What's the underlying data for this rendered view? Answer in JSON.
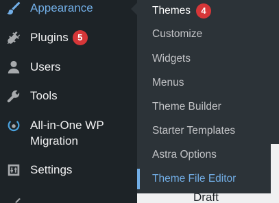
{
  "sidebar": {
    "items": [
      {
        "label": "Appearance",
        "icon": "paintbrush-icon",
        "active": true
      },
      {
        "label": "Plugins",
        "icon": "plug-icon",
        "badge": "5"
      },
      {
        "label": "Users",
        "icon": "user-icon"
      },
      {
        "label": "Tools",
        "icon": "wrench-icon"
      },
      {
        "label_line1": "All-in-One WP",
        "label_line2": "Migration",
        "icon": "migration-icon"
      },
      {
        "label": "Settings",
        "icon": "settings-sliders-icon"
      }
    ]
  },
  "submenu": {
    "items": [
      {
        "label": "Themes",
        "badge": "4"
      },
      {
        "label": "Customize"
      },
      {
        "label": "Widgets"
      },
      {
        "label": "Menus"
      },
      {
        "label": "Theme Builder"
      },
      {
        "label": "Starter Templates"
      },
      {
        "label": "Astra Options"
      },
      {
        "label": "Theme File Editor",
        "current": true
      }
    ]
  },
  "content": {
    "partial_text": "Draft"
  },
  "colors": {
    "sidebar_bg": "#1d2327",
    "submenu_bg": "#2c3338",
    "accent": "#72aee6",
    "badge": "#d63638"
  }
}
